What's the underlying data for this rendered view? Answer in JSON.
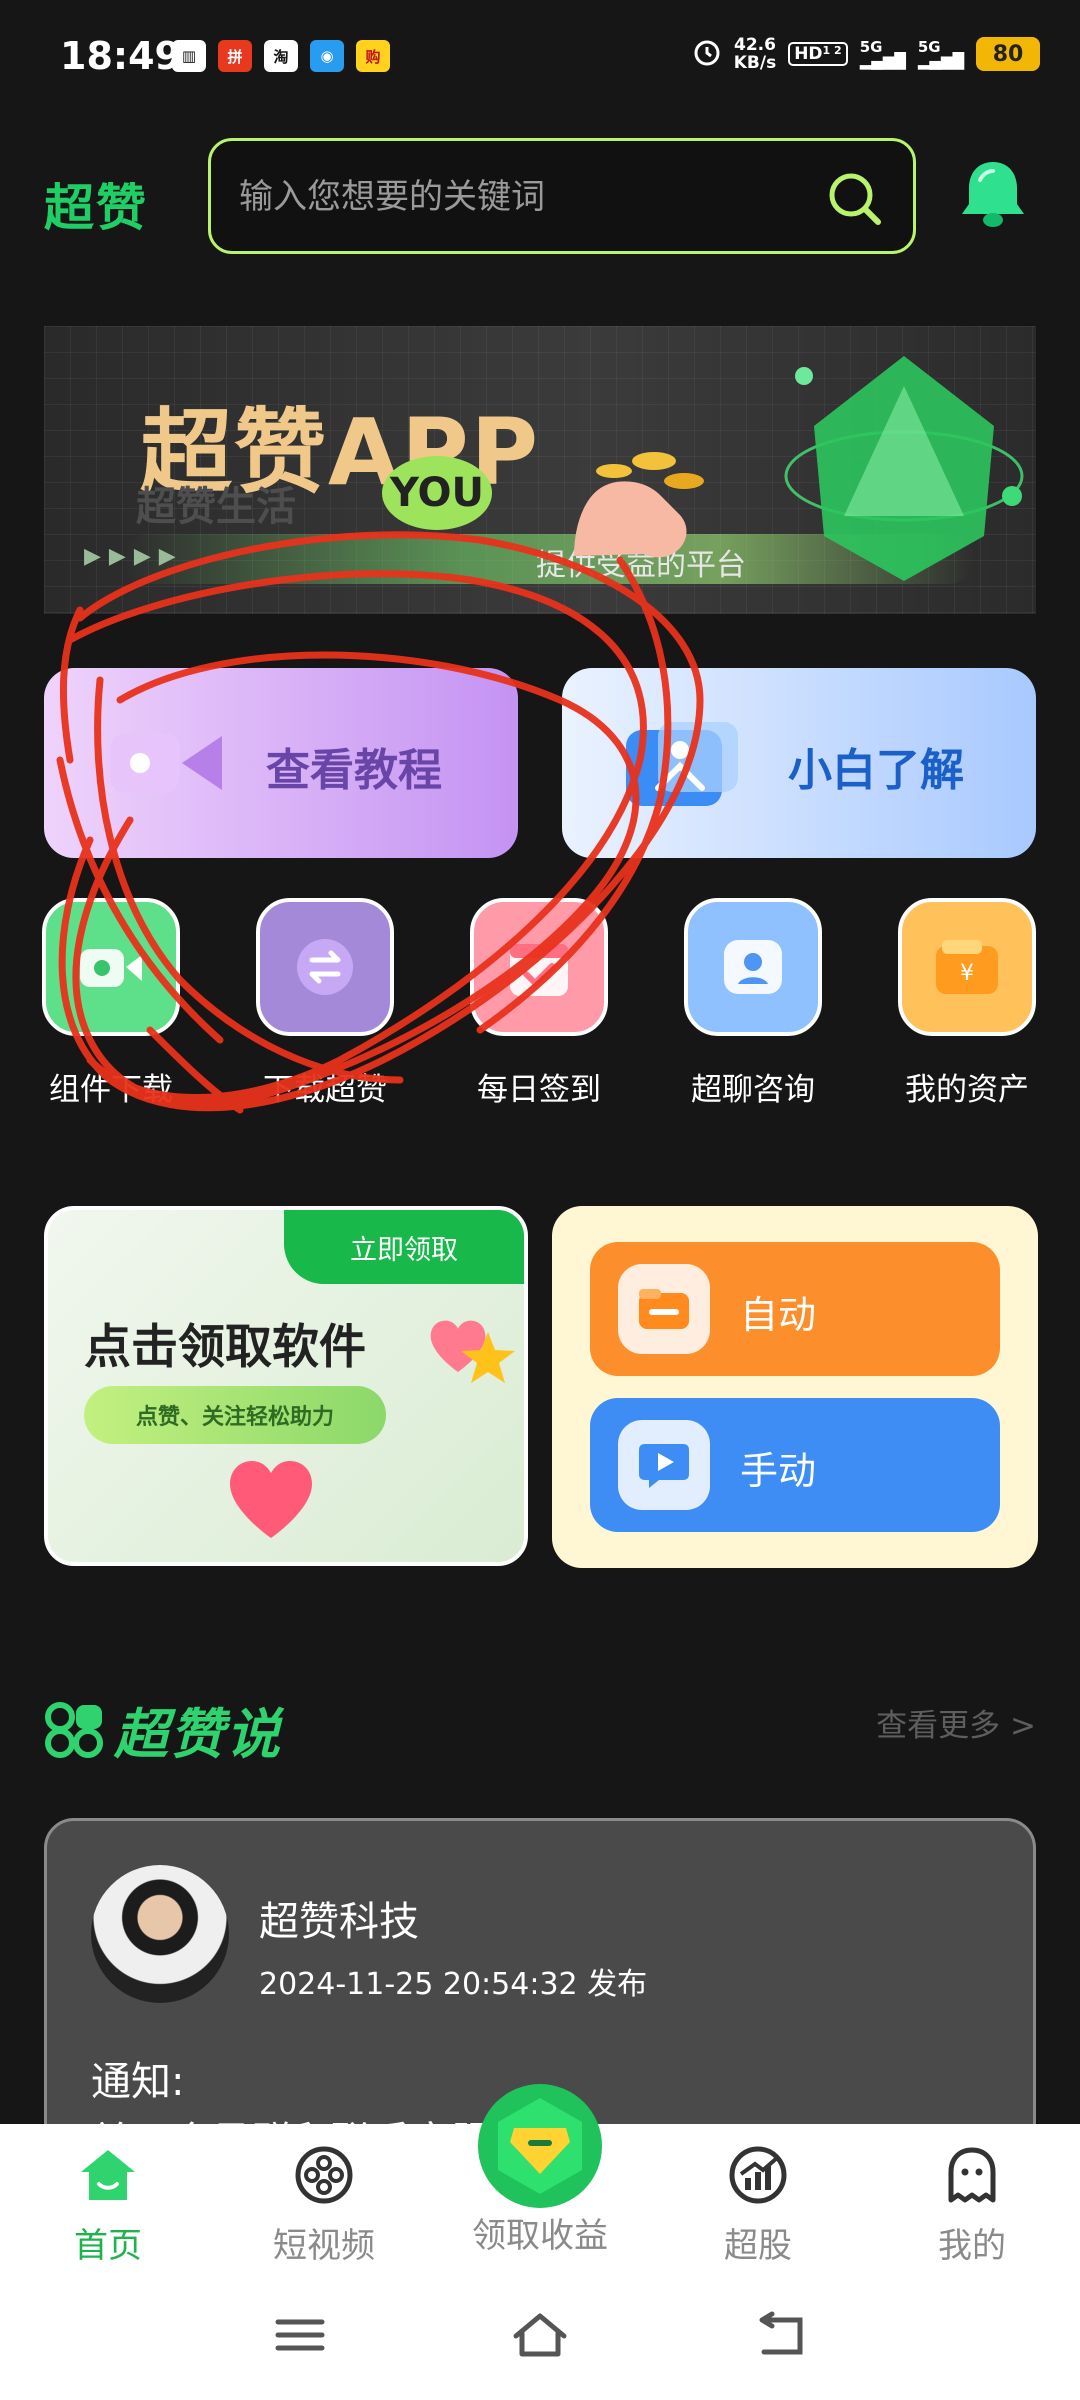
{
  "status_bar": {
    "time": "18:49",
    "apps": [
      {
        "icon": "book-app-icon",
        "text": "▥",
        "bg": "#ffffff",
        "fg": "#161616"
      },
      {
        "icon": "pinduoduo-app-icon",
        "text": "拼",
        "bg": "#e8381f",
        "fg": "#ffffff"
      },
      {
        "icon": "taobao-app-icon",
        "text": "淘",
        "bg": "#ffffff",
        "fg": "#161616"
      },
      {
        "icon": "message-app-icon",
        "text": "◉",
        "bg": "#2a9cf0",
        "fg": "#ffffff"
      },
      {
        "icon": "shopping-app-icon",
        "text": "购",
        "bg": "#ffd21e",
        "fg": "#c0161f"
      }
    ],
    "net_speed_value": "42.6",
    "net_speed_unit": "KB/s",
    "hd": "HD",
    "hd_sub": "1 2",
    "signal_1": "5G",
    "signal_2": "5G",
    "battery": "80"
  },
  "header": {
    "logo": "超赞",
    "search_placeholder": "输入您想要的关键词"
  },
  "banner": {
    "title": "超赞APP",
    "subtitle": "超赞生活",
    "badge": "YOU",
    "tagline": "提供受益的平台"
  },
  "actions": {
    "tutorial": "查看教程",
    "learn": "小白了解"
  },
  "shortcuts": [
    {
      "label": "组件下载",
      "icon": "camera-icon",
      "bg": "#5ee08a"
    },
    {
      "label": "下载超赞",
      "icon": "exchange-icon",
      "bg": "#a389d8"
    },
    {
      "label": "每日签到",
      "icon": "calendar-check-icon",
      "bg": "#ff9aa8"
    },
    {
      "label": "超聊咨询",
      "icon": "contact-icon",
      "bg": "#8fc0ff"
    },
    {
      "label": "我的资产",
      "icon": "wallet-icon",
      "bg": "#ffc25a"
    }
  ],
  "promo": {
    "tag": "立即领取",
    "title": "点击领取软件",
    "pill": "点赞、关注轻松助力"
  },
  "modes": {
    "auto": "自动",
    "manual": "手动"
  },
  "section": {
    "title": "超赞说",
    "more": "查看更多 >"
  },
  "post": {
    "author": "超赞科技",
    "time": "2024-11-25 20:54:32 发布",
    "heading": "通知:",
    "line": "关于会员群和联系客服问题"
  },
  "bottom_nav": {
    "home": "首页",
    "video": "短视频",
    "earn": "领取收益",
    "stock": "超股",
    "mine": "我的"
  },
  "colors": {
    "accent": "#1fcf66",
    "search_border": "#b9f36b",
    "annotation": "#e8321c"
  }
}
